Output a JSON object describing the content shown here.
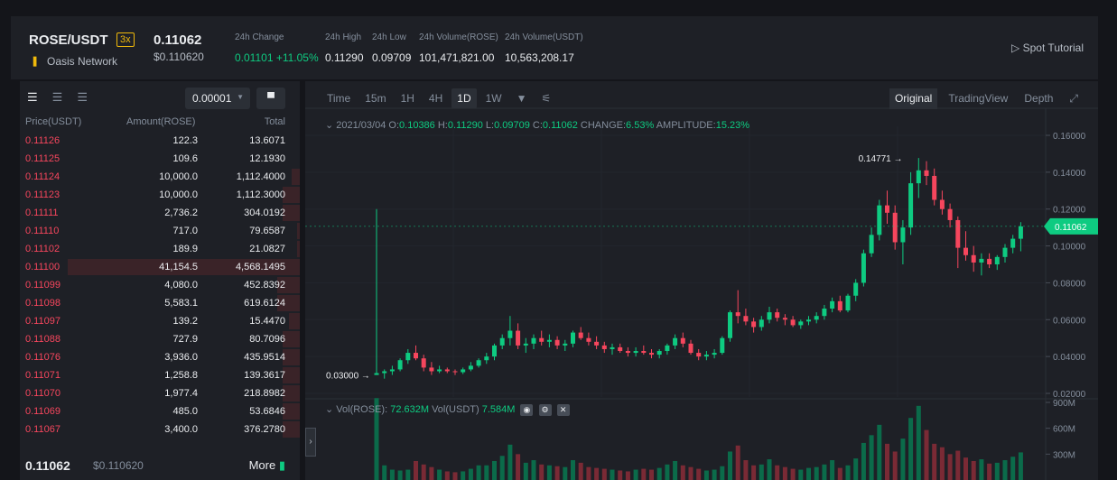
{
  "header": {
    "symbol": "ROSE/USDT",
    "leverage": "3x",
    "network": "Oasis Network",
    "last_price": "0.11062",
    "last_price_usd": "$0.110620",
    "stats": [
      {
        "label": "24h Change",
        "value": "0.01101 +11.05%",
        "color": "green"
      },
      {
        "label": "24h High",
        "value": "0.11290"
      },
      {
        "label": "24h Low",
        "value": "0.09709"
      },
      {
        "label": "24h Volume(ROSE)",
        "value": "101,471,821.00"
      },
      {
        "label": "24h Volume(USDT)",
        "value": "10,563,208.17"
      }
    ],
    "tutorial": "Spot Tutorial"
  },
  "orderbook": {
    "precision": "0.00001",
    "col_price": "Price(USDT)",
    "col_amount": "Amount(ROSE)",
    "col_total": "Total",
    "rows": [
      {
        "price": "0.11126",
        "amount": "122.3",
        "total": "13.6071",
        "depth": 0
      },
      {
        "price": "0.11125",
        "amount": "109.6",
        "total": "12.1930",
        "depth": 0
      },
      {
        "price": "0.11124",
        "amount": "10,000.0",
        "total": "1,112.4000",
        "depth": 0.03
      },
      {
        "price": "0.11123",
        "amount": "10,000.0",
        "total": "1,112.3000",
        "depth": 0.06
      },
      {
        "price": "0.11111",
        "amount": "2,736.2",
        "total": "304.0192",
        "depth": 0.06
      },
      {
        "price": "0.11110",
        "amount": "717.0",
        "total": "79.6587",
        "depth": 0.01
      },
      {
        "price": "0.11102",
        "amount": "189.9",
        "total": "21.0827",
        "depth": 0.01
      },
      {
        "price": "0.11100",
        "amount": "41,154.5",
        "total": "4,568.1495",
        "depth": 0.83
      },
      {
        "price": "0.11099",
        "amount": "4,080.0",
        "total": "452.8392",
        "depth": 0.08
      },
      {
        "price": "0.11098",
        "amount": "5,583.1",
        "total": "619.6124",
        "depth": 0.08
      },
      {
        "price": "0.11097",
        "amount": "139.2",
        "total": "15.4470",
        "depth": 0.04
      },
      {
        "price": "0.11088",
        "amount": "727.9",
        "total": "80.7096",
        "depth": 0.06
      },
      {
        "price": "0.11076",
        "amount": "3,936.0",
        "total": "435.9514",
        "depth": 0.06
      },
      {
        "price": "0.11071",
        "amount": "1,258.8",
        "total": "139.3617",
        "depth": 0.06
      },
      {
        "price": "0.11070",
        "amount": "1,977.4",
        "total": "218.8982",
        "depth": 0.06
      },
      {
        "price": "0.11069",
        "amount": "485.0",
        "total": "53.6846",
        "depth": 0.06
      },
      {
        "price": "0.11067",
        "amount": "3,400.0",
        "total": "376.2780",
        "depth": 0.06
      }
    ],
    "footer_price": "0.11062",
    "footer_usd": "$0.110620",
    "more": "More"
  },
  "chart": {
    "intervals": [
      "Time",
      "15m",
      "1H",
      "4H",
      "1D",
      "1W"
    ],
    "active_interval": "1D",
    "views": [
      "Original",
      "TradingView",
      "Depth"
    ],
    "active_view": "Original",
    "ohlc": {
      "date": "2021/03/04",
      "o_label": "O:",
      "o": "0.10386",
      "h_label": "H:",
      "h": "0.11290",
      "l_label": "L:",
      "l": "0.09709",
      "c_label": "C:",
      "c": "0.11062",
      "change_label": "CHANGE:",
      "change": "6.53%",
      "amp_label": "AMPLITUDE:",
      "amp": "15.23%"
    },
    "vol": {
      "l1": "Vol(ROSE):",
      "v1": "72.632M",
      "l2": "Vol(USDT)",
      "v2": "7.584M"
    },
    "max_label": "0.14771",
    "min_label": "0.03000",
    "current_label": "0.11062",
    "y_ticks": [
      "0.16000",
      "0.14000",
      "0.12000",
      "0.10000",
      "0.08000",
      "0.06000",
      "0.04000",
      "0.02000"
    ],
    "vol_ticks": [
      "900M",
      "600M",
      "300M"
    ],
    "colors": {
      "up": "#0ecb81",
      "down": "#f6465d"
    }
  },
  "chart_data": {
    "type": "candlestick",
    "ylim": [
      0.02,
      0.16
    ],
    "candles": [
      [
        0.03,
        0.12,
        0.03,
        0.031
      ],
      [
        0.031,
        0.033,
        0.028,
        0.032
      ],
      [
        0.032,
        0.035,
        0.03,
        0.033
      ],
      [
        0.033,
        0.039,
        0.032,
        0.038
      ],
      [
        0.038,
        0.044,
        0.036,
        0.042
      ],
      [
        0.042,
        0.046,
        0.038,
        0.039
      ],
      [
        0.039,
        0.041,
        0.032,
        0.034
      ],
      [
        0.034,
        0.037,
        0.03,
        0.032
      ],
      [
        0.032,
        0.035,
        0.031,
        0.033
      ],
      [
        0.033,
        0.034,
        0.031,
        0.032
      ],
      [
        0.032,
        0.033,
        0.03,
        0.0315
      ],
      [
        0.0315,
        0.034,
        0.0305,
        0.033
      ],
      [
        0.033,
        0.037,
        0.032,
        0.035
      ],
      [
        0.035,
        0.039,
        0.034,
        0.038
      ],
      [
        0.038,
        0.042,
        0.036,
        0.04
      ],
      [
        0.04,
        0.047,
        0.038,
        0.046
      ],
      [
        0.046,
        0.052,
        0.044,
        0.05
      ],
      [
        0.05,
        0.062,
        0.046,
        0.054
      ],
      [
        0.054,
        0.058,
        0.044,
        0.046
      ],
      [
        0.046,
        0.05,
        0.042,
        0.047
      ],
      [
        0.047,
        0.052,
        0.044,
        0.05
      ],
      [
        0.05,
        0.054,
        0.046,
        0.048
      ],
      [
        0.048,
        0.052,
        0.045,
        0.049
      ],
      [
        0.049,
        0.051,
        0.044,
        0.046
      ],
      [
        0.046,
        0.049,
        0.043,
        0.047
      ],
      [
        0.047,
        0.054,
        0.045,
        0.053
      ],
      [
        0.053,
        0.056,
        0.049,
        0.05
      ],
      [
        0.05,
        0.053,
        0.046,
        0.048
      ],
      [
        0.048,
        0.051,
        0.044,
        0.046
      ],
      [
        0.046,
        0.048,
        0.042,
        0.044
      ],
      [
        0.044,
        0.047,
        0.041,
        0.045
      ],
      [
        0.045,
        0.047,
        0.042,
        0.043
      ],
      [
        0.043,
        0.045,
        0.04,
        0.042
      ],
      [
        0.042,
        0.045,
        0.04,
        0.043
      ],
      [
        0.043,
        0.046,
        0.041,
        0.042
      ],
      [
        0.042,
        0.044,
        0.039,
        0.041
      ],
      [
        0.041,
        0.044,
        0.039,
        0.043
      ],
      [
        0.043,
        0.047,
        0.041,
        0.046
      ],
      [
        0.046,
        0.052,
        0.044,
        0.05
      ],
      [
        0.05,
        0.053,
        0.045,
        0.047
      ],
      [
        0.047,
        0.049,
        0.041,
        0.042
      ],
      [
        0.042,
        0.044,
        0.038,
        0.04
      ],
      [
        0.04,
        0.043,
        0.038,
        0.041
      ],
      [
        0.041,
        0.044,
        0.039,
        0.042
      ],
      [
        0.042,
        0.051,
        0.041,
        0.05
      ],
      [
        0.05,
        0.065,
        0.048,
        0.064
      ],
      [
        0.064,
        0.076,
        0.058,
        0.062
      ],
      [
        0.062,
        0.066,
        0.057,
        0.059
      ],
      [
        0.059,
        0.061,
        0.053,
        0.056
      ],
      [
        0.056,
        0.062,
        0.054,
        0.06
      ],
      [
        0.06,
        0.067,
        0.058,
        0.064
      ],
      [
        0.064,
        0.066,
        0.059,
        0.061
      ],
      [
        0.061,
        0.063,
        0.057,
        0.06
      ],
      [
        0.06,
        0.062,
        0.056,
        0.057
      ],
      [
        0.057,
        0.06,
        0.055,
        0.059
      ],
      [
        0.059,
        0.062,
        0.057,
        0.06
      ],
      [
        0.06,
        0.064,
        0.058,
        0.062
      ],
      [
        0.062,
        0.068,
        0.06,
        0.066
      ],
      [
        0.066,
        0.072,
        0.064,
        0.07
      ],
      [
        0.07,
        0.073,
        0.064,
        0.065
      ],
      [
        0.065,
        0.074,
        0.064,
        0.073
      ],
      [
        0.073,
        0.082,
        0.07,
        0.08
      ],
      [
        0.08,
        0.098,
        0.078,
        0.096
      ],
      [
        0.096,
        0.11,
        0.094,
        0.106
      ],
      [
        0.106,
        0.125,
        0.103,
        0.122
      ],
      [
        0.122,
        0.13,
        0.112,
        0.118
      ],
      [
        0.118,
        0.122,
        0.098,
        0.102
      ],
      [
        0.102,
        0.114,
        0.09,
        0.11
      ],
      [
        0.11,
        0.14,
        0.106,
        0.134
      ],
      [
        0.134,
        0.1477,
        0.126,
        0.141
      ],
      [
        0.141,
        0.146,
        0.133,
        0.138
      ],
      [
        0.138,
        0.142,
        0.122,
        0.125
      ],
      [
        0.125,
        0.13,
        0.117,
        0.12
      ],
      [
        0.12,
        0.123,
        0.11,
        0.114
      ],
      [
        0.114,
        0.116,
        0.088,
        0.099
      ],
      [
        0.099,
        0.108,
        0.092,
        0.095
      ],
      [
        0.095,
        0.1,
        0.086,
        0.091
      ],
      [
        0.091,
        0.096,
        0.084,
        0.093
      ],
      [
        0.093,
        0.096,
        0.088,
        0.09
      ],
      [
        0.09,
        0.095,
        0.087,
        0.094
      ],
      [
        0.094,
        0.101,
        0.091,
        0.099
      ],
      [
        0.099,
        0.106,
        0.096,
        0.1039
      ],
      [
        0.1039,
        0.1129,
        0.0971,
        0.1106
      ]
    ],
    "volume": [
      950,
      170,
      120,
      110,
      120,
      220,
      180,
      150,
      120,
      100,
      90,
      100,
      130,
      170,
      170,
      220,
      280,
      410,
      300,
      200,
      230,
      180,
      170,
      160,
      150,
      230,
      200,
      150,
      140,
      130,
      120,
      110,
      100,
      120,
      130,
      120,
      140,
      180,
      220,
      170,
      150,
      130,
      110,
      120,
      160,
      330,
      400,
      230,
      170,
      180,
      240,
      170,
      150,
      130,
      120,
      140,
      150,
      180,
      230,
      140,
      170,
      250,
      430,
      520,
      640,
      420,
      330,
      480,
      720,
      860,
      580,
      420,
      380,
      300,
      340,
      260,
      220,
      240,
      190,
      200,
      230,
      270,
      320
    ]
  }
}
